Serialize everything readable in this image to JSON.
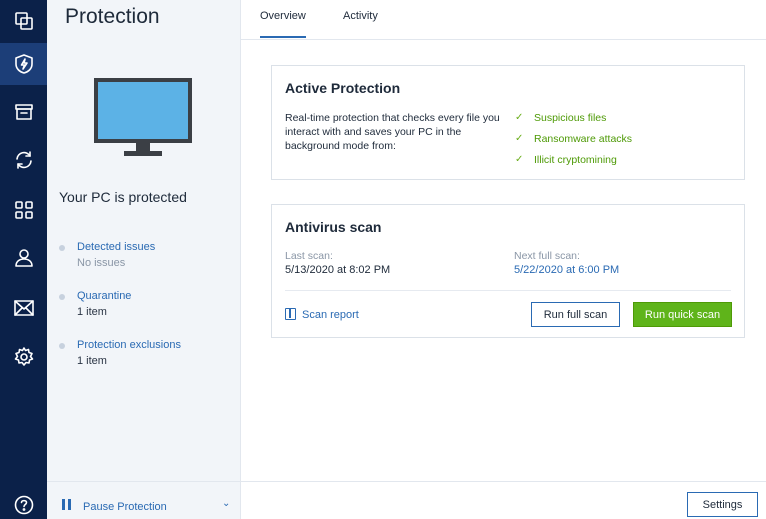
{
  "rail": {
    "items": [
      {
        "icon": "copy-icon"
      },
      {
        "icon": "shield-lightning-icon",
        "active": true
      },
      {
        "icon": "archive-icon"
      },
      {
        "icon": "sync-icon"
      },
      {
        "icon": "grid-icon"
      },
      {
        "icon": "user-icon"
      },
      {
        "icon": "mail-icon"
      },
      {
        "icon": "gear-icon"
      },
      {
        "icon": "help-icon"
      }
    ]
  },
  "sidebar": {
    "title": "Protection",
    "status": "Your PC is protected",
    "entries": [
      {
        "label": "Detected issues",
        "value": "No issues"
      },
      {
        "label": "Quarantine",
        "value": "1 item"
      },
      {
        "label": "Protection exclusions",
        "value": "1 item"
      }
    ],
    "pause_label": "Pause Protection"
  },
  "tabs": [
    {
      "label": "Overview",
      "active": true
    },
    {
      "label": "Activity",
      "active": false
    }
  ],
  "active_protection": {
    "title": "Active Protection",
    "description": "Real-time protection that checks every file you interact with and saves your PC in the background mode from:",
    "items": [
      "Suspicious files",
      "Ransomware attacks",
      "Illicit cryptomining"
    ]
  },
  "antivirus": {
    "title": "Antivirus scan",
    "last_label": "Last scan:",
    "last_value": "5/13/2020 at 8:02 PM",
    "next_label": "Next full scan:",
    "next_value": "5/22/2020 at 6:00 PM",
    "report_label": "Scan report",
    "full_scan_label": "Run full scan",
    "quick_scan_label": "Run quick scan"
  },
  "footer": {
    "settings_label": "Settings"
  },
  "colors": {
    "rail_bg": "#0b2149",
    "rail_active": "#1c3e78",
    "accent_blue": "#2a6ab3",
    "accent_green": "#5fb41a",
    "side_bg": "#f2f5f9"
  }
}
